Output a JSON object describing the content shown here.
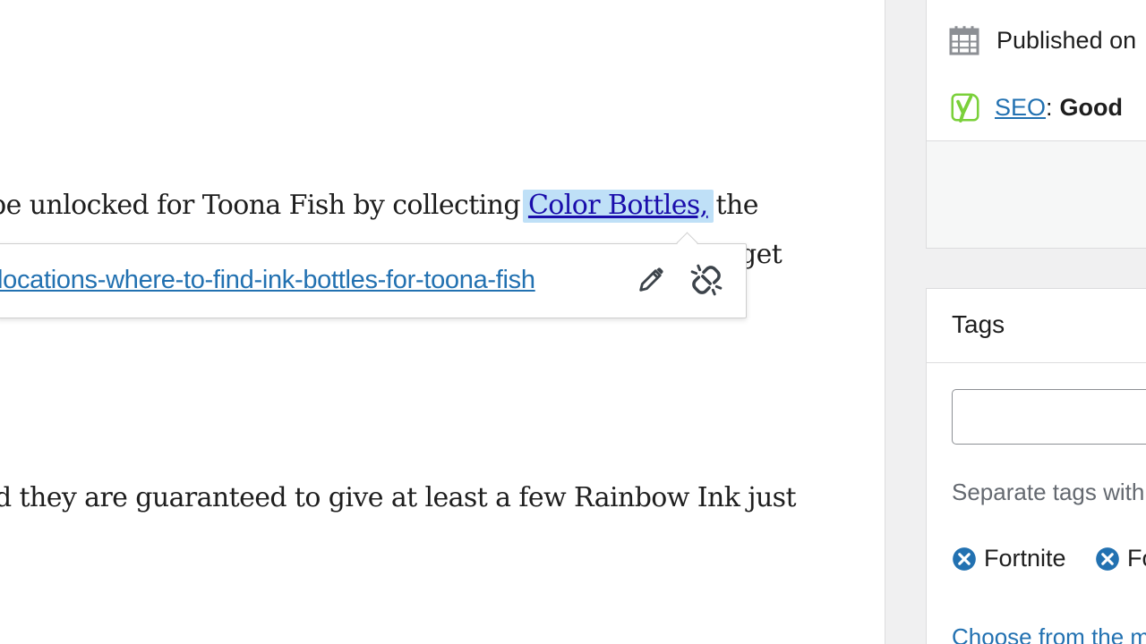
{
  "editor": {
    "para1_before": "be unlocked for Toona Fish by collecting ",
    "para1_link": "Color Bottles,",
    "para1_after": " the",
    "para1_line2_tail": "get",
    "para2": "d they are guaranteed to give at least a few Rainbow Ink just",
    "link_popover": {
      "url": "locations-where-to-find-ink-bottles-for-toona-fish"
    }
  },
  "sidebar": {
    "publish": {
      "published_text": "Published on",
      "seo_link": "SEO",
      "seo_colon": ":",
      "seo_rating": "Good"
    },
    "tags": {
      "title": "Tags",
      "input_value": "",
      "hint": "Separate tags with commas",
      "chips": [
        "Fortnite",
        "Fortnite Battle Pass"
      ],
      "choose_link": "Choose from the most used tags"
    }
  },
  "colors": {
    "link": "#2271b1",
    "link_selected_bg": "#bfe0f7",
    "yoast_green": "#7ad03a",
    "sidebar_bg": "#f0f0f1"
  },
  "icons": [
    "edit-pencil-icon",
    "unlink-icon",
    "calendar-icon",
    "yoast-icon",
    "remove-tag-icon"
  ]
}
